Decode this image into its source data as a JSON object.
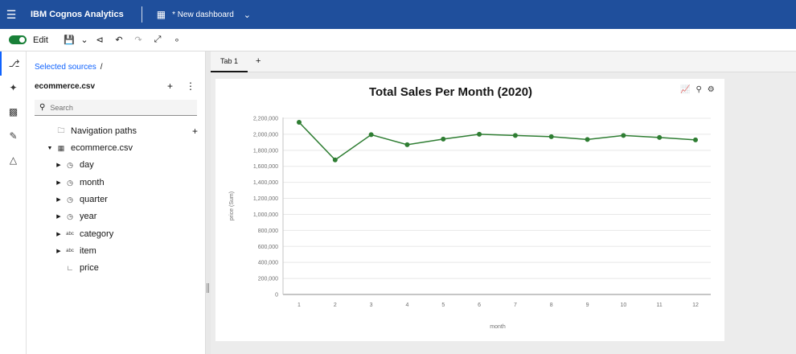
{
  "header": {
    "menu_icon": "hamburger-icon",
    "app_name": "IBM Cognos Analytics",
    "dashboard_icon": "dashboard-icon",
    "dashboard_name": "* New dashboard"
  },
  "toolbar": {
    "edit_label": "Edit"
  },
  "panel": {
    "breadcrumb": "Selected sources",
    "breadcrumb_sep": "/",
    "source_name": "ecommerce.csv",
    "search_placeholder": "Search",
    "tree": [
      {
        "label": "Navigation paths",
        "icon": "folder-icon",
        "caret": ""
      },
      {
        "label": "ecommerce.csv",
        "icon": "table-icon",
        "caret": "▼"
      },
      {
        "label": "day",
        "icon": "clock-icon",
        "caret": "▶"
      },
      {
        "label": "month",
        "icon": "clock-icon",
        "caret": "▶"
      },
      {
        "label": "quarter",
        "icon": "clock-icon",
        "caret": "▶"
      },
      {
        "label": "year",
        "icon": "clock-icon",
        "caret": "▶"
      },
      {
        "label": "category",
        "icon": "abc-icon",
        "caret": "▶"
      },
      {
        "label": "item",
        "icon": "abc-icon",
        "caret": "▶"
      },
      {
        "label": "price",
        "icon": "measure-icon",
        "caret": ""
      }
    ]
  },
  "tabs": {
    "tab1": "Tab 1",
    "add": "+"
  },
  "colors": {
    "header_bg": "#1f4f9c",
    "line": "#2e7d32",
    "accent": "#0f62fe"
  },
  "chart_data": {
    "type": "line",
    "title": "Total Sales Per Month (2020)",
    "xlabel": "month",
    "ylabel": "price (Sum)",
    "categories": [
      "1",
      "2",
      "3",
      "4",
      "5",
      "6",
      "7",
      "8",
      "9",
      "10",
      "11",
      "12"
    ],
    "series": [
      {
        "values": [
          2150000,
          1680000,
          1995000,
          1870000,
          1940000,
          2000000,
          1985000,
          1970000,
          1935000,
          1985000,
          1960000,
          1930000
        ]
      }
    ],
    "ylim": [
      0,
      2200000
    ],
    "yticks": [
      "0",
      "200,000",
      "400,000",
      "600,000",
      "800,000",
      "1,000,000",
      "1,200,000",
      "1,400,000",
      "1,600,000",
      "1,800,000",
      "2,000,000",
      "2,200,000"
    ],
    "grid": true
  }
}
